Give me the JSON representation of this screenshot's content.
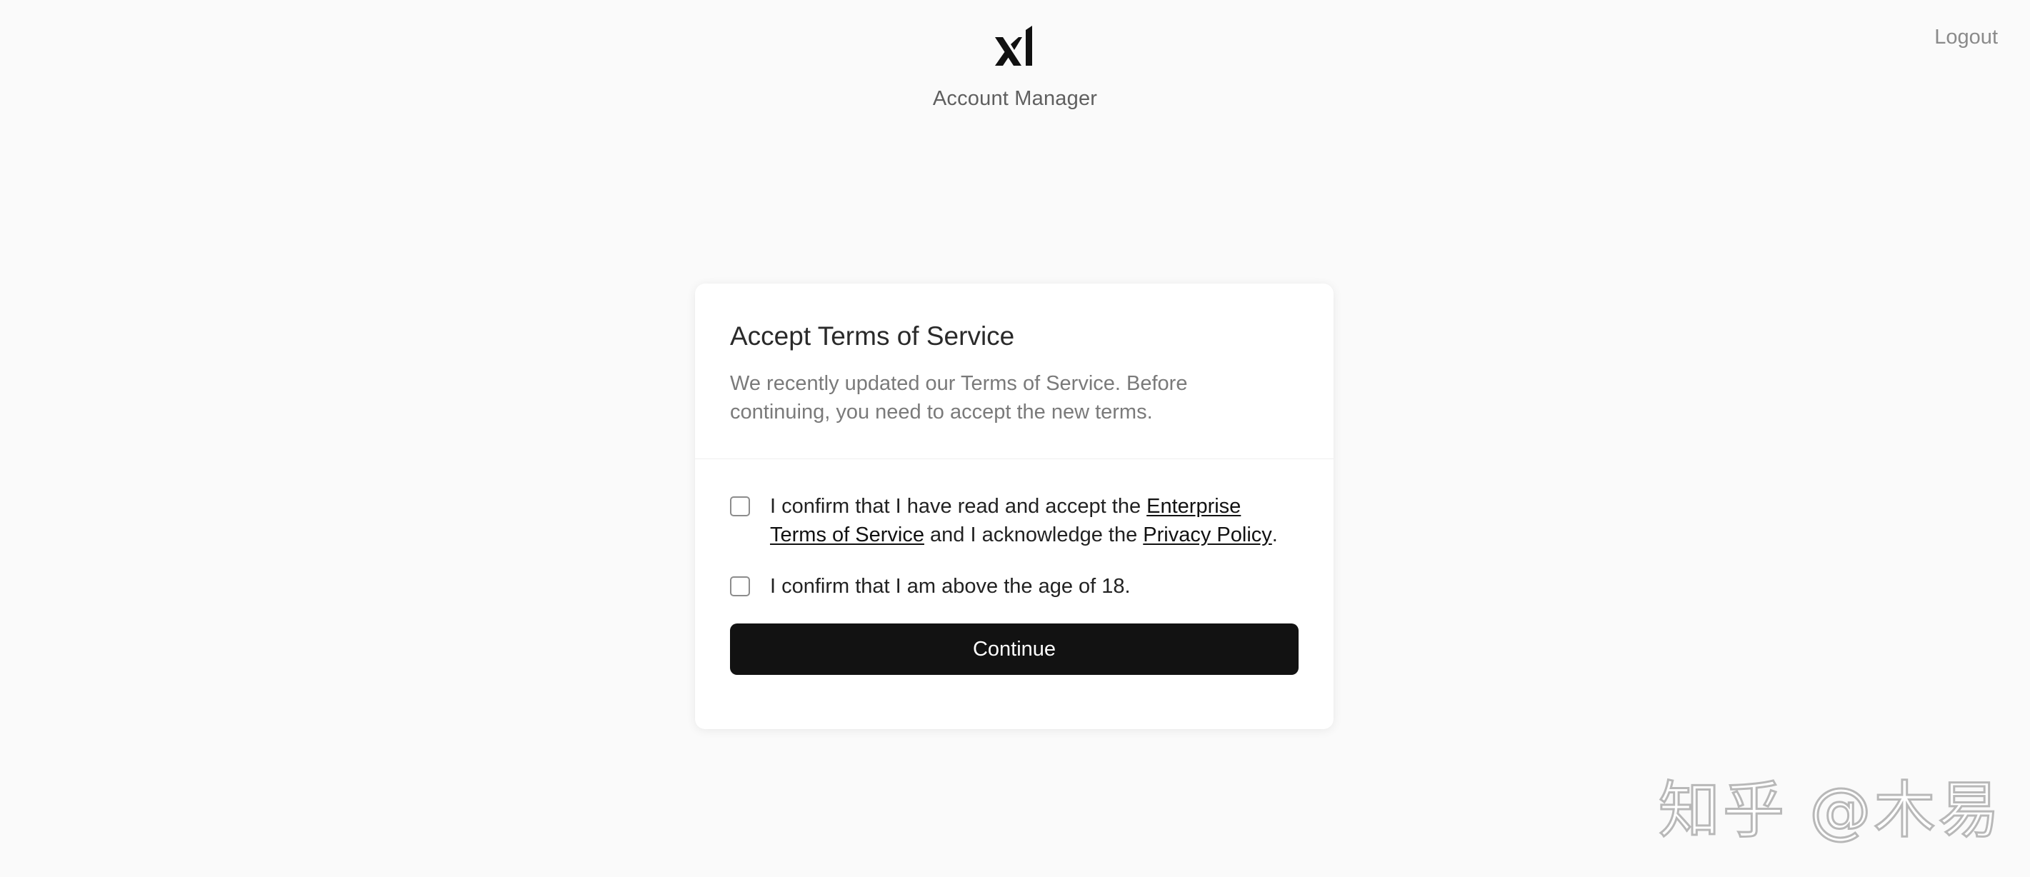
{
  "header": {
    "app_title": "Account Manager",
    "logout_label": "Logout"
  },
  "card": {
    "title": "Accept Terms of Service",
    "description": "We recently updated our Terms of Service. Before continuing, you need to accept the new terms.",
    "terms_prefix": "I confirm that I have read and accept the ",
    "terms_link": "Enterprise Terms of Service",
    "terms_middle": " and I acknowledge the ",
    "privacy_link": "Privacy Policy",
    "terms_suffix": ".",
    "age_label": "I confirm that I am above the age of 18.",
    "continue_label": "Continue"
  },
  "watermark": "知乎 @木易",
  "colors": {
    "background": "#fafafa",
    "card": "#ffffff",
    "button": "#121212",
    "button_text": "#ffffff"
  },
  "icons": {
    "logo": "xai-logo-icon"
  }
}
